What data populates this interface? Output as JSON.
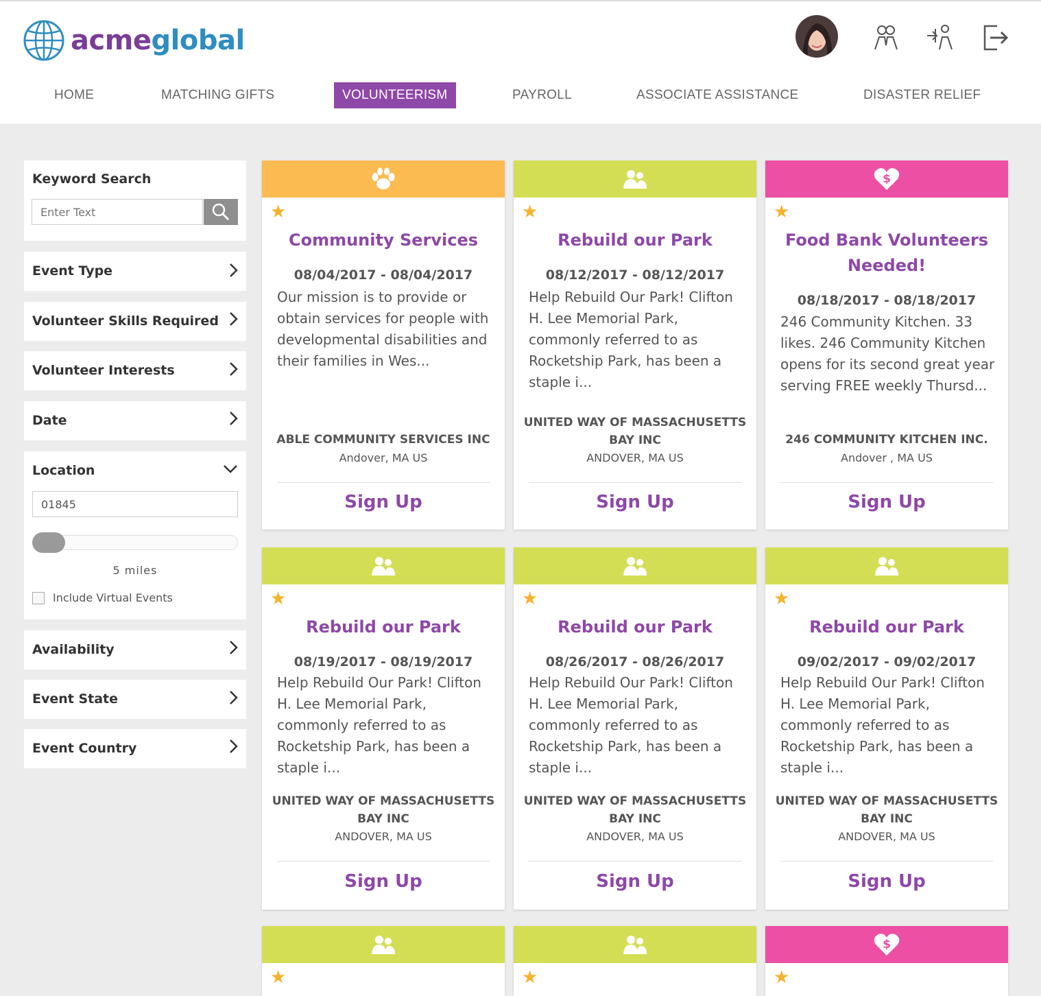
{
  "brand": {
    "part1": "acme",
    "part2": "global"
  },
  "nav": [
    {
      "label": "HOME"
    },
    {
      "label": "MATCHING GIFTS"
    },
    {
      "label": "VOLUNTEERISM"
    },
    {
      "label": "PAYROLL"
    },
    {
      "label": "ASSOCIATE ASSISTANCE"
    },
    {
      "label": "DISASTER RELIEF"
    }
  ],
  "header_icons": [
    "user-avatar",
    "people-icon",
    "share-people-icon",
    "logout-icon"
  ],
  "sidebar": {
    "keyword_title": "Keyword Search",
    "keyword_placeholder": "Enter Text",
    "event_type": "Event Type",
    "skills": "Volunteer Skills Required",
    "interests": "Volunteer Interests",
    "date": "Date",
    "location": "Location",
    "location_value": "01845",
    "radius_miles": 5,
    "miles_label": "5  miles",
    "virtual_label": "Include Virtual Events",
    "availability": "Availability",
    "event_state": "Event State",
    "event_country": "Event Country"
  },
  "colors": {
    "accent": "#8e48a8",
    "orange": "#fbbb51",
    "green": "#d4de55",
    "pink": "#ec4fa3",
    "star": "#f5b22e"
  },
  "cards": [
    {
      "category": "paw-icon",
      "title": "Community Services",
      "date": "08/04/2017 - 08/04/2017",
      "desc": "Our mission is to provide or obtain services for people with developmental disabilities and their families in Wes...",
      "org": "ABLE COMMUNITY SERVICES INC",
      "loc": "Andover, MA US",
      "signup": "Sign Up"
    },
    {
      "category": "people-icon",
      "title": "Rebuild our Park",
      "date": "08/12/2017 - 08/12/2017",
      "desc": "Help Rebuild Our Park! Clifton H. Lee Memorial Park, commonly referred to as Rocketship Park, has been a staple i...",
      "org": "UNITED WAY OF MASSACHUSETTS BAY INC",
      "loc": "ANDOVER, MA US",
      "signup": "Sign Up"
    },
    {
      "category": "heart-dollar-icon",
      "title": "Food Bank Volunteers Needed!",
      "date": "08/18/2017 - 08/18/2017",
      "desc": "246 Community Kitchen. 33 likes. 246 Community Kitchen opens for its second great year serving FREE weekly Thursd...",
      "org": "246 COMMUNITY KITCHEN INC.",
      "loc": "Andover , MA US",
      "signup": "Sign Up"
    },
    {
      "category": "people-icon",
      "title": "Rebuild our Park",
      "date": "08/19/2017 - 08/19/2017",
      "desc": "Help Rebuild Our Park! Clifton H. Lee Memorial Park, commonly referred to as Rocketship Park, has been a staple i...",
      "org": "UNITED WAY OF MASSACHUSETTS BAY INC",
      "loc": "ANDOVER, MA US",
      "signup": "Sign Up"
    },
    {
      "category": "people-icon",
      "title": "Rebuild our Park",
      "date": "08/26/2017 - 08/26/2017",
      "desc": "Help Rebuild Our Park! Clifton H. Lee Memorial Park, commonly referred to as Rocketship Park, has been a staple i...",
      "org": "UNITED WAY OF MASSACHUSETTS BAY INC",
      "loc": "ANDOVER, MA US",
      "signup": "Sign Up"
    },
    {
      "category": "people-icon",
      "title": "Rebuild our Park",
      "date": "09/02/2017 - 09/02/2017",
      "desc": "Help Rebuild Our Park! Clifton H. Lee Memorial Park, commonly referred to as Rocketship Park, has been a staple i...",
      "org": "UNITED WAY OF MASSACHUSETTS BAY INC",
      "loc": "ANDOVER, MA US",
      "signup": "Sign Up"
    },
    {
      "category": "people-icon"
    },
    {
      "category": "people-icon"
    },
    {
      "category": "heart-dollar-icon"
    }
  ]
}
